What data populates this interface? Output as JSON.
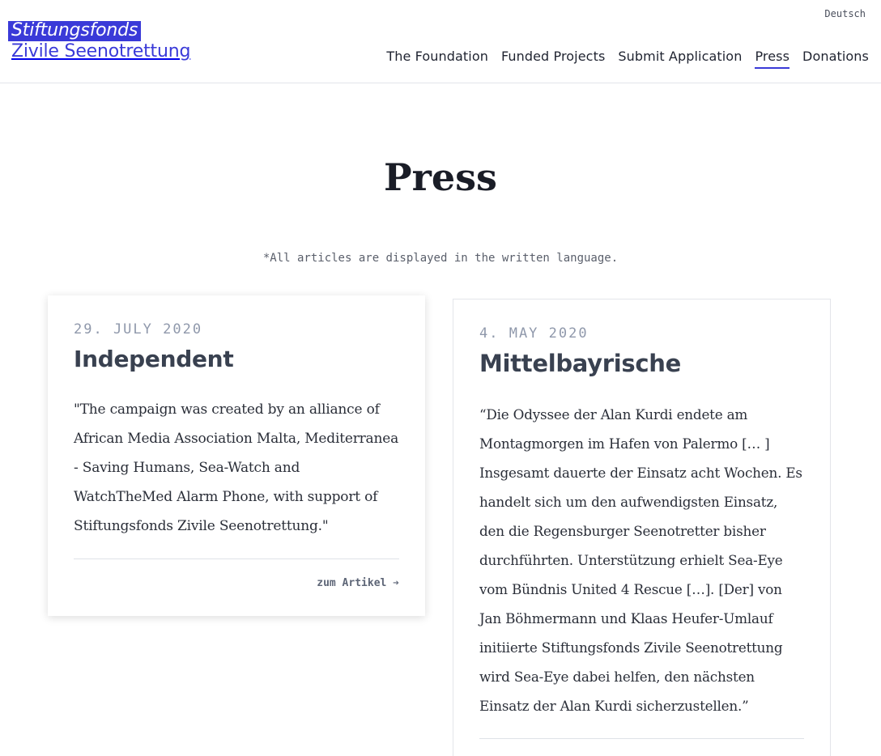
{
  "header": {
    "logo_line1": "Stiftungsfonds",
    "logo_line2": "Zivile Seenotrettung",
    "language_link": "Deutsch",
    "nav": [
      {
        "label": "The Foundation"
      },
      {
        "label": "Funded Projects"
      },
      {
        "label": "Submit Application"
      },
      {
        "label": "Press",
        "active": true
      },
      {
        "label": "Donations"
      }
    ]
  },
  "main": {
    "title": "Press",
    "note": "*All articles are displayed in the written language.",
    "articles": [
      {
        "date": "29. JULY 2020",
        "source": "Independent",
        "quote": "\"The campaign was created by an alliance of African Media Association Malta, Mediterranea - Saving Humans, Sea-Watch and WatchTheMed Alarm Phone, with support of Stiftungsfonds Zivile Seenotrettung.\"",
        "link_label": "zum Artikel ➔"
      },
      {
        "date": "4. MAY 2020",
        "source": "Mittelbayrische",
        "quote": "“Die Odyssee der Alan Kurdi endete am Montagmorgen im Hafen von Palermo [… ] Insgesamt dauerte der Einsatz acht Wochen. Es handelt sich um den aufwendigsten Einsatz, den die Regensburger Seenotretter bisher durchführten. Unterstützung erhielt Sea-Eye vom Bündnis United 4 Rescue […]. [Der] von Jan Böhmermann und Klaas Heufer-Umlauf initiierte Stiftungsfonds Zivile Seenotrettung wird Sea-Eye dabei helfen, den nächsten Einsatz der Alan Kurdi sicherzustellen.”"
      }
    ]
  },
  "colors": {
    "accent": "#3a3ad8",
    "text": "#1f2330",
    "muted": "#8f98ab"
  }
}
